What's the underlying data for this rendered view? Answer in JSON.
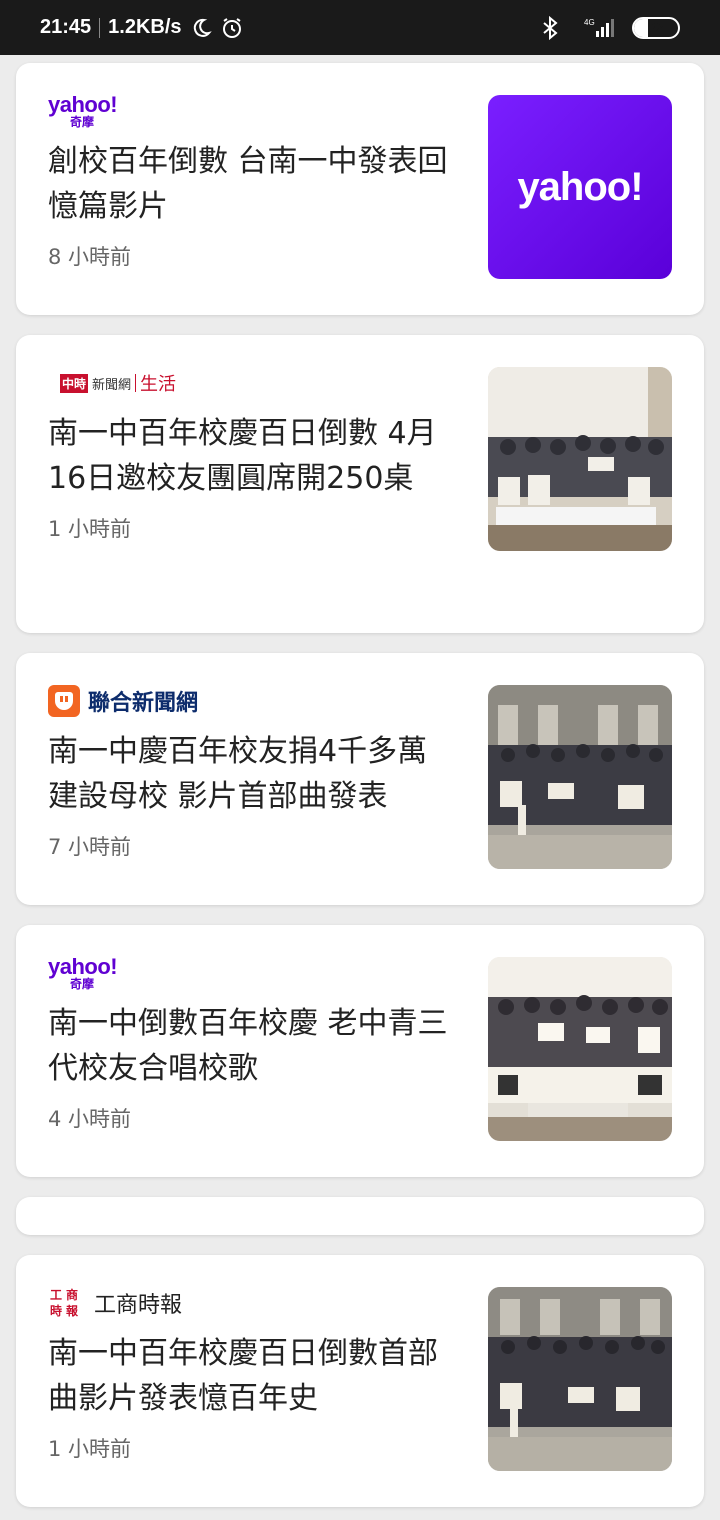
{
  "status_bar": {
    "time": "21:45",
    "speed": "1.2KB/s",
    "network": "4G",
    "battery": "32"
  },
  "colors": {
    "yahoo_purple": "#6001d2",
    "chinatimes_red": "#c8102e",
    "udn_orange": "#f26522",
    "udn_navy": "#0d2c6c"
  },
  "articles": [
    {
      "source": "yahoo!",
      "source_sub": "奇摩",
      "headline": "創校百年倒數 台南一中發表回憶篇影片",
      "time": "8 小時前",
      "thumb_text": "yahoo!"
    },
    {
      "source_badge": "中時",
      "source": "新聞網",
      "source_category": "生活",
      "headline": "南一中百年校慶百日倒數 4月16日邀校友團圓席開250桌",
      "time": "1 小時前"
    },
    {
      "source": "聯合新聞網",
      "headline": "南一中慶百年校友捐4千多萬建設母校 影片首部曲發表",
      "time": "7 小時前"
    },
    {
      "source": "yahoo!",
      "source_sub": "奇摩",
      "headline": "南一中倒數百年校慶 老中青三代校友合唱校歌",
      "time": "4 小時前"
    },
    {
      "source_logo": [
        "工",
        "商",
        "時",
        "報"
      ],
      "source": "工商時報",
      "headline": "南一中百年校慶百日倒數首部曲影片發表憶百年史",
      "time": "1 小時前"
    }
  ]
}
